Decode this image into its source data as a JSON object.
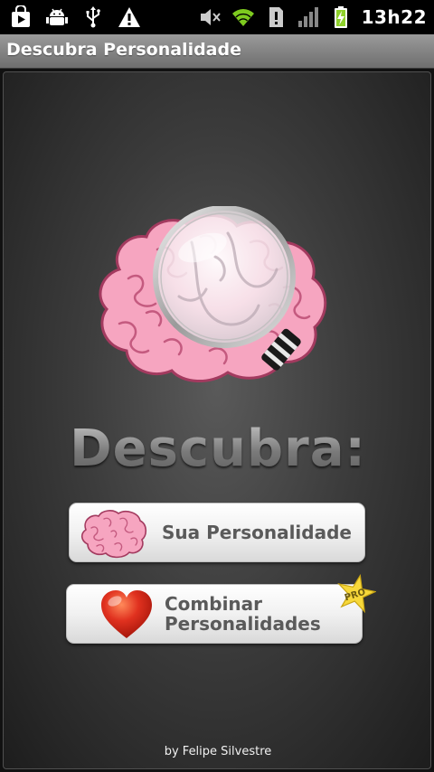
{
  "status_bar": {
    "time": "13h22",
    "icons_left": [
      "store-bag-icon",
      "android-debug-icon",
      "usb-icon",
      "warning-icon"
    ],
    "icons_right": [
      "mute-icon",
      "wifi-icon",
      "sim-alert-icon",
      "signal-icon",
      "battery-charging-icon"
    ]
  },
  "titlebar": {
    "title": "Descubra Personalidade"
  },
  "main": {
    "logo_icon": "brain-magnifier-icon",
    "headline": "Descubra:",
    "buttons": [
      {
        "label": "Sua Personalidade",
        "icon": "brain-icon"
      },
      {
        "label_line1": "Combinar",
        "label_line2": "Personalidades",
        "icon": "heart-icon",
        "badge": "PRO"
      }
    ],
    "credit": "by Felipe Silvestre"
  },
  "colors": {
    "brain_pink": "#f6a5c0",
    "heart_red": "#e0311f",
    "pro_star": "#f7d83a",
    "wifi_green": "#7ecb1f",
    "battery_green": "#8fd12b"
  }
}
